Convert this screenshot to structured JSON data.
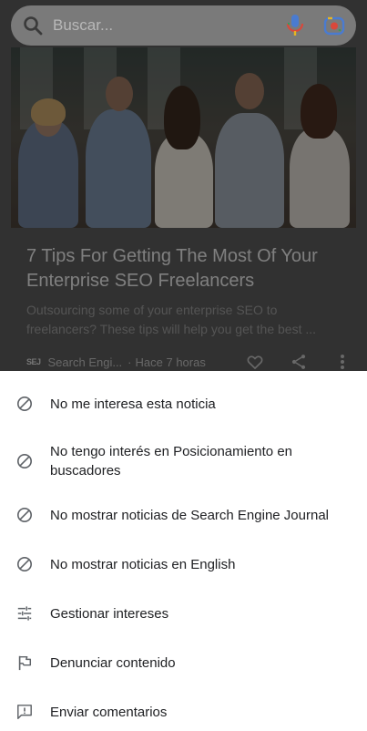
{
  "search": {
    "placeholder": "Buscar..."
  },
  "article": {
    "headline": "7 Tips For Getting The Most Of Your Enterprise SEO Freelancers",
    "snippet_line1": "Outsourcing some of your enterprise SEO to",
    "snippet_line2": "freelancers? These tips will help you get the best ...",
    "source_logo": "SEJ",
    "source_name": "Search Engi...",
    "separator": "·",
    "time": "Hace 7 horas"
  },
  "menu": {
    "items": [
      {
        "label": "No me interesa esta noticia",
        "icon": "block-icon"
      },
      {
        "label": "No tengo interés en Posicionamiento en buscadores",
        "icon": "block-icon"
      },
      {
        "label": "No mostrar noticias de Search Engine Journal",
        "icon": "block-icon"
      },
      {
        "label": "No mostrar noticias en English",
        "icon": "block-icon"
      },
      {
        "label": "Gestionar intereses",
        "icon": "tune-icon"
      },
      {
        "label": "Denunciar contenido",
        "icon": "flag-icon"
      },
      {
        "label": "Enviar comentarios",
        "icon": "feedback-icon"
      }
    ]
  },
  "colors": {
    "mic_blue": "#4a7bd0",
    "mic_red": "#d9483b",
    "mic_yellow": "#e6b422",
    "mic_green": "#3a9a5a",
    "menu_text": "#202124",
    "menu_icon": "#5f6368"
  }
}
